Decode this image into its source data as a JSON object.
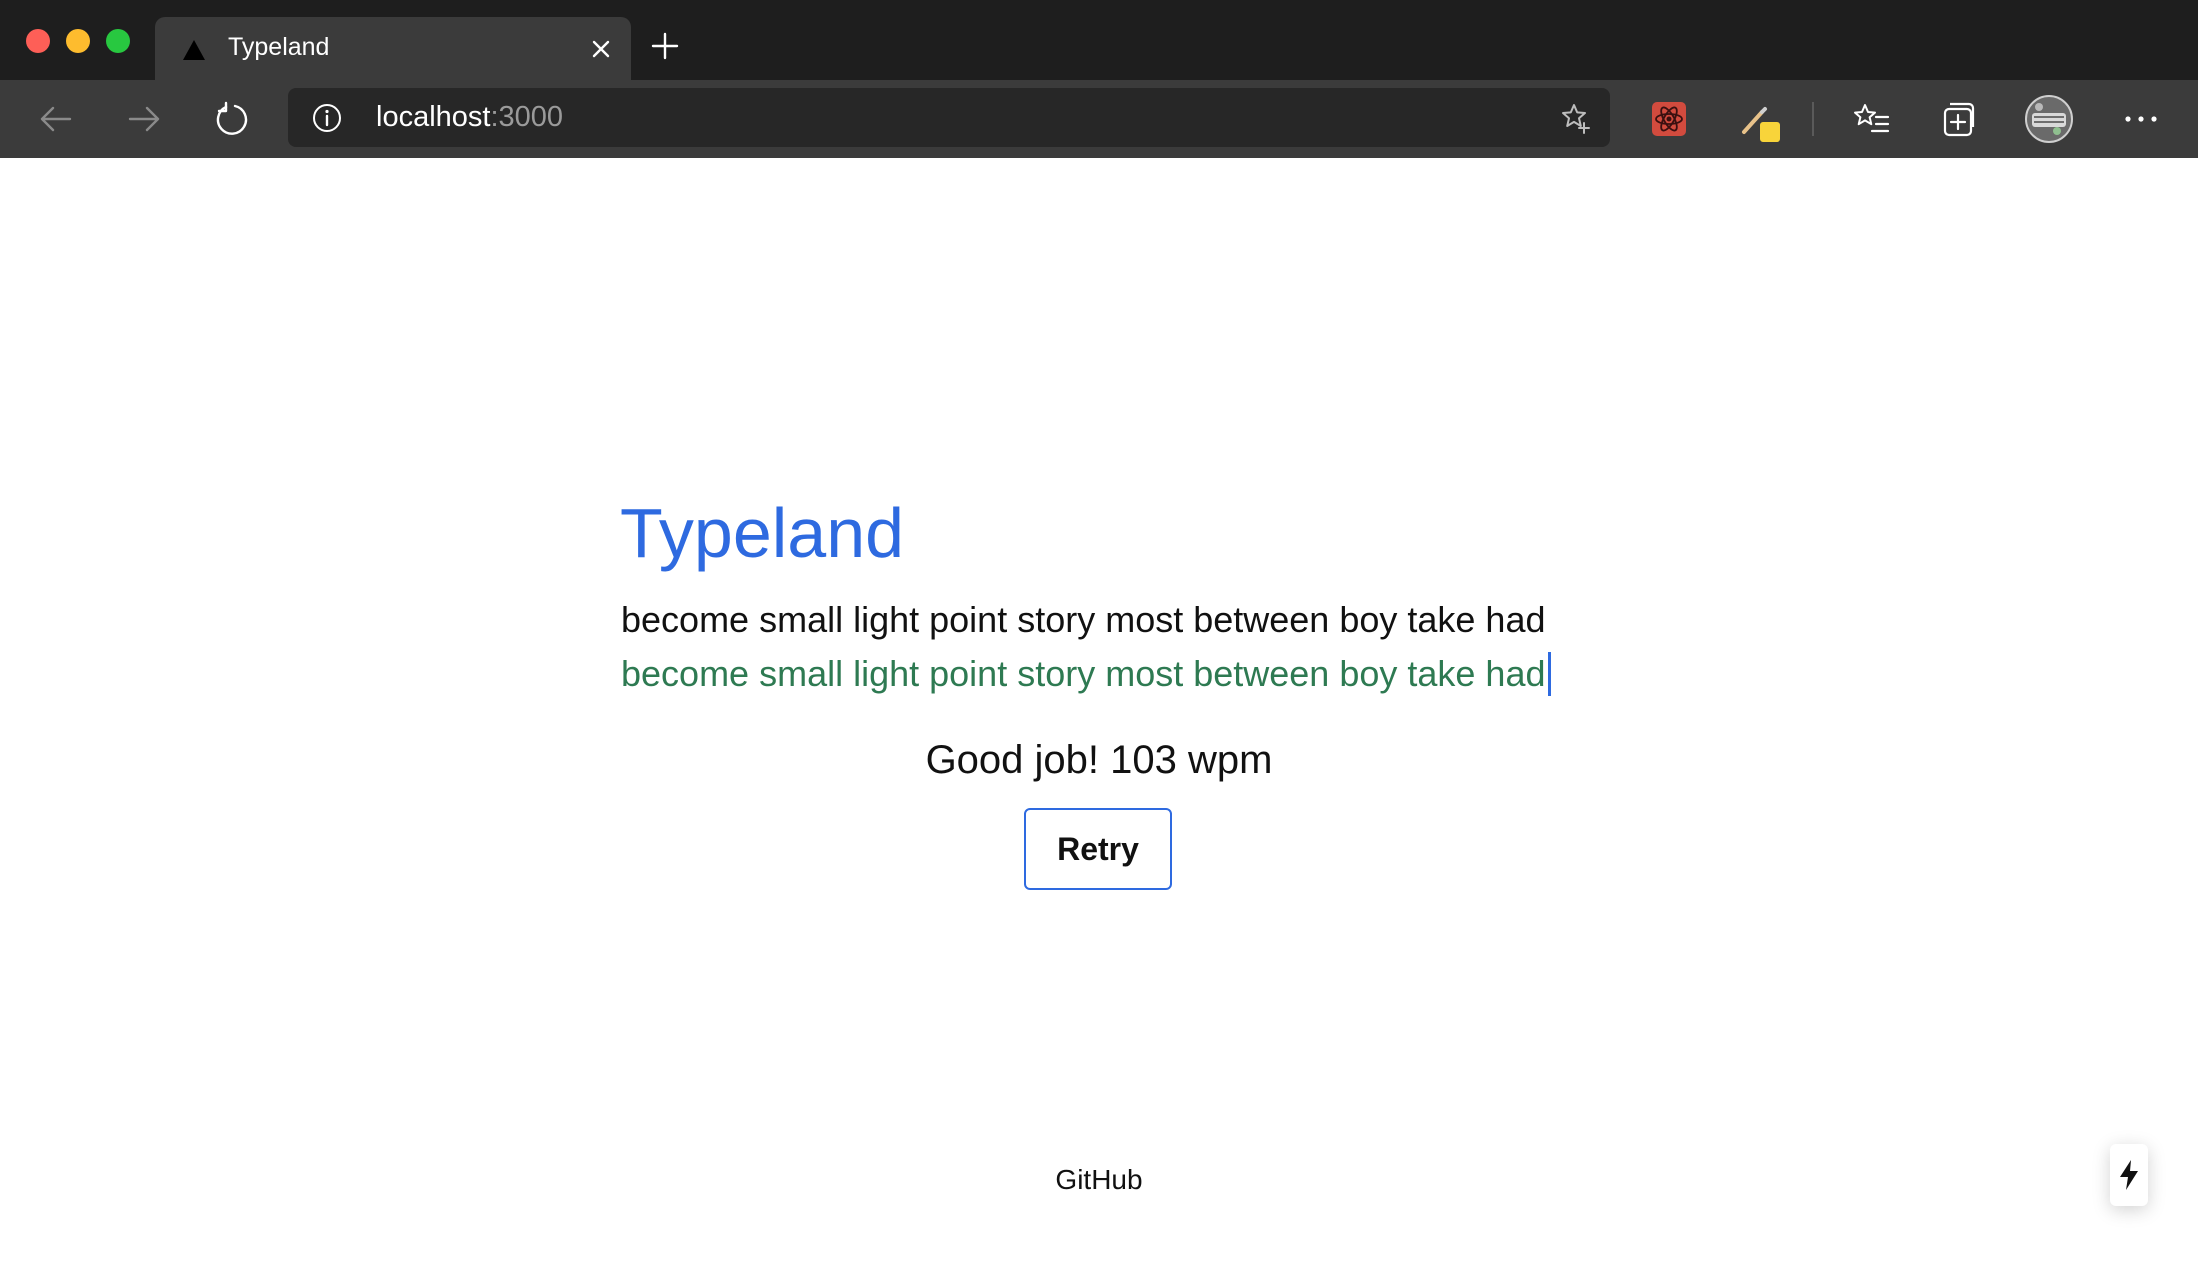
{
  "browser": {
    "tab_title": "Typeland",
    "url_host": "localhost",
    "url_port": ":3000"
  },
  "page": {
    "title": "Typeland",
    "target_text": "become small light point story most between boy take had",
    "typed_text": "become small light point story most between boy take had",
    "result_text": "Good job! 103 wpm",
    "retry_label": "Retry",
    "footer_link": "GitHub"
  },
  "colors": {
    "title": "#2e6ae0",
    "typed_correct": "#2e7a52",
    "caret": "#2e6ae0",
    "button_border": "#2e6ae0"
  },
  "icons": {
    "back": "arrow-left-icon",
    "forward": "arrow-right-icon",
    "reload": "reload-icon",
    "info": "info-icon",
    "favorite": "star-plus-icon",
    "extension1": "react-devtools-icon",
    "extension2": "pen-sticky-icon",
    "favorites": "favorites-list-icon",
    "collections": "collections-icon",
    "profile": "avatar",
    "more": "more-icon",
    "indicator": "lightning-icon"
  }
}
